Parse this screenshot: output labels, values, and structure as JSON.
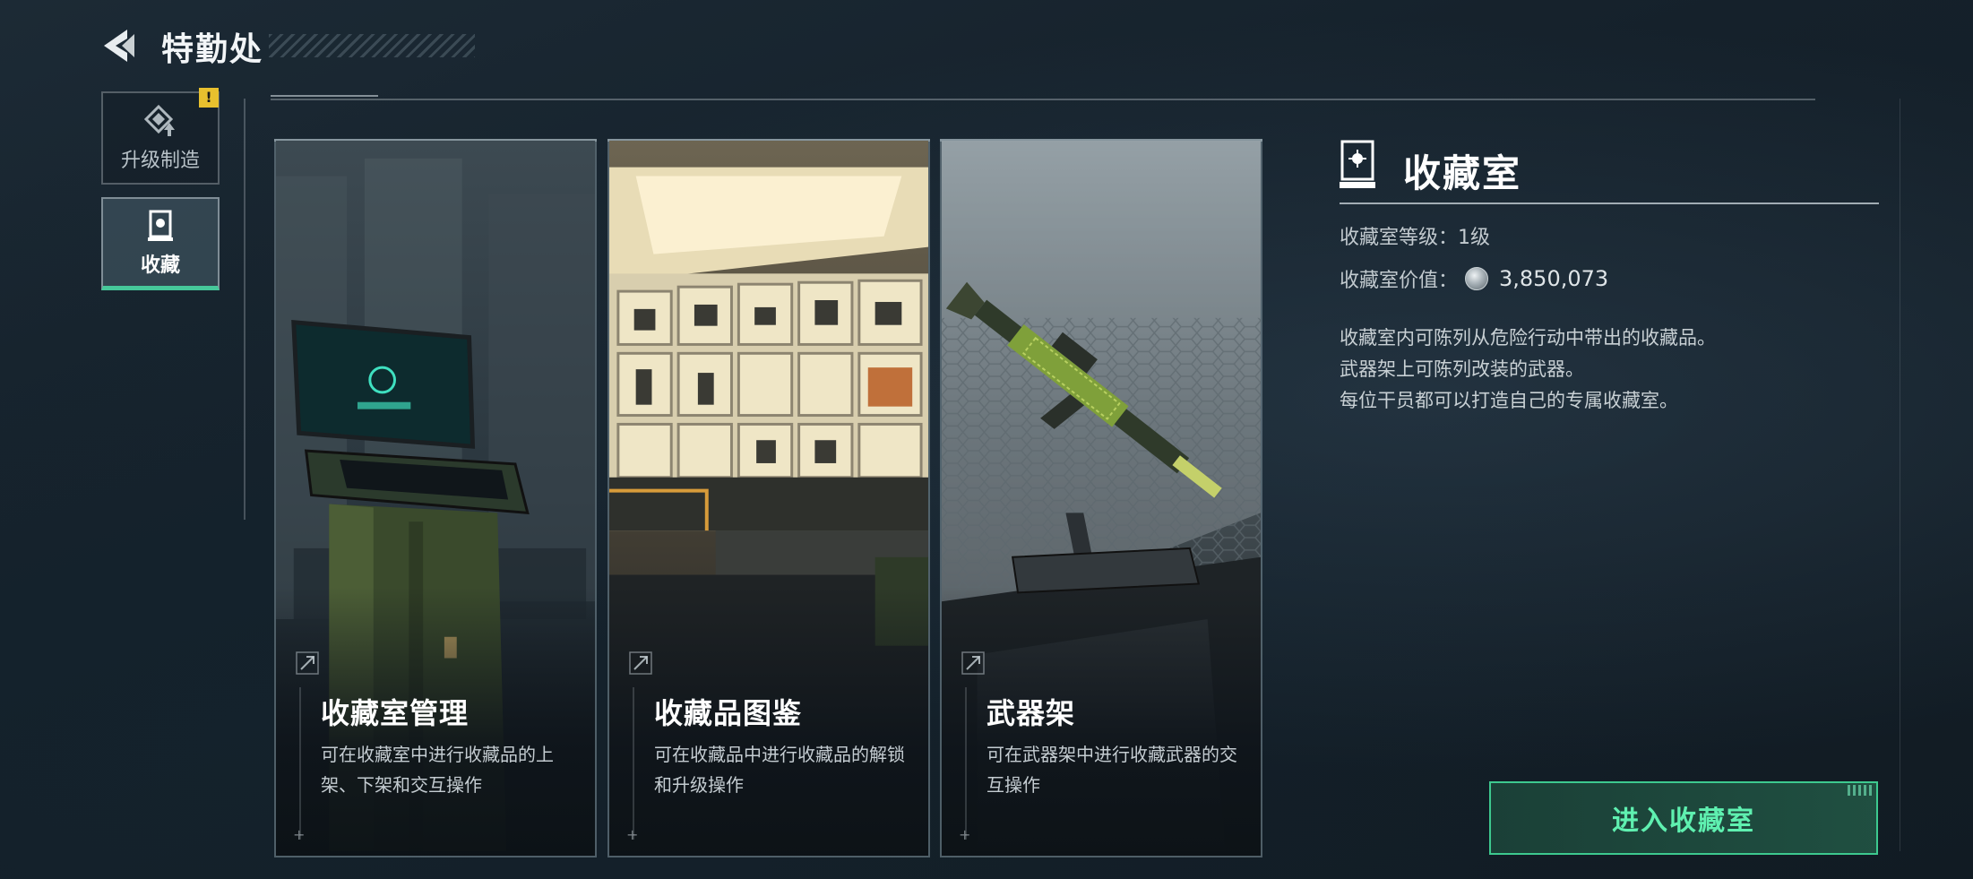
{
  "header": {
    "title": "特勤处",
    "back_icon": "back-arrow-icon"
  },
  "side_tabs": [
    {
      "label": "升级制造",
      "icon": "upgrade-craft-icon",
      "selected": false,
      "has_alert": true,
      "alert_symbol": "!"
    },
    {
      "label": "收藏",
      "icon": "collection-icon",
      "selected": true,
      "has_alert": false
    }
  ],
  "cards": [
    {
      "title": "收藏室管理",
      "desc": "可在收藏室中进行收藏品的上架、下架和交互操作",
      "art": "terminal-scene"
    },
    {
      "title": "收藏品图鉴",
      "desc": "可在收藏品中进行收藏品的解锁和升级操作",
      "art": "display-cabinet-scene"
    },
    {
      "title": "武器架",
      "desc": "可在武器架中进行收藏武器的交互操作",
      "art": "weapon-rack-scene"
    }
  ],
  "info": {
    "title": "收藏室",
    "level_label": "收藏室等级：1级",
    "value_label": "收藏室价值：",
    "value": "3,850,073",
    "desc_lines": [
      "收藏室内可陈列从危险行动中带出的收藏品。",
      "武器架上可陈列改装的武器。",
      "每位干员都可以打造自己的专属收藏室。"
    ]
  },
  "enter_button": {
    "label": "进入收藏室"
  },
  "colors": {
    "accent_green": "#3dc98f",
    "alert_yellow": "#e8c02e",
    "bg_dark": "#15212b"
  }
}
